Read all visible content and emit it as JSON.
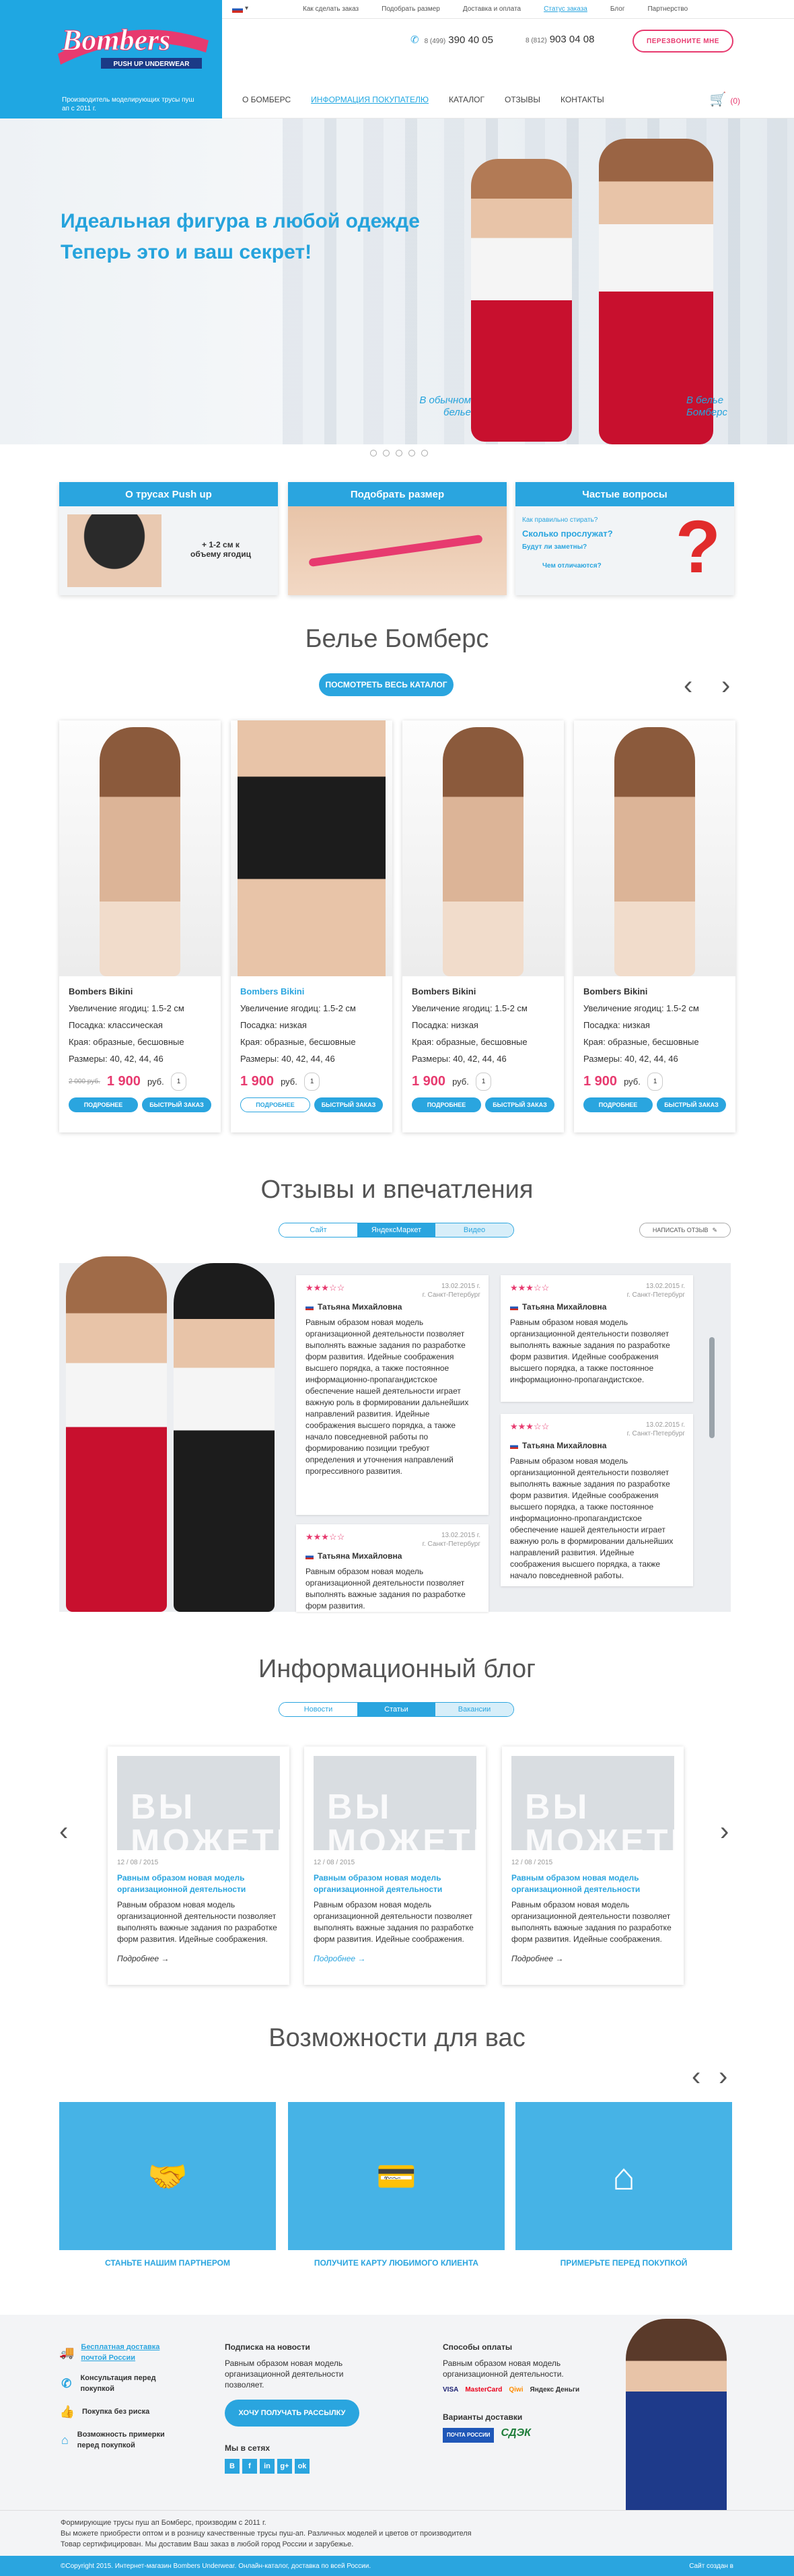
{
  "topbar": {
    "lang": "▾",
    "links": [
      "Как сделать заказ",
      "Подобрать размер",
      "Доставка и оплата",
      "Статус заказа",
      "Блог",
      "Партнерство"
    ]
  },
  "header": {
    "logo_text": "Bombers",
    "logo_sub": "PUSH UP UNDERWEAR",
    "tagline": "Производитель моделирующих трусы пуш ап с 2011 г.",
    "phone1_code": "8 (499)",
    "phone1": "390 40 05",
    "phone2_code": "8 (812)",
    "phone2": "903 04 08",
    "call_button": "ПЕРЕЗВОНИТЕ МНЕ",
    "cart_count": "(0)"
  },
  "nav": [
    "О БОМБЕРС",
    "ИНФОРМАЦИЯ ПОКУПАТЕЛЮ",
    "КАТАЛОГ",
    "ОТЗЫВЫ",
    "КОНТАКТЫ"
  ],
  "hero": {
    "line1": "Идеальная фигура в любой одежде",
    "line2": "Теперь это и ваш секрет!",
    "caption_left": "В обычном белье",
    "caption_right": "В белье Бомберс"
  },
  "features": [
    {
      "title": "О трусах Push up",
      "note": "+ 1-2 см к объему ягодиц"
    },
    {
      "title": "Подобрать размер"
    },
    {
      "title": "Частые вопросы",
      "q1": "Как правильно стирать?",
      "q2": "Сколько прослужат?",
      "q3": "Будут ли заметны?",
      "q4": "Чем отличаются?"
    }
  ],
  "catalog": {
    "title": "Белье Бомберс",
    "view_all": "ПОСМОТРЕТЬ ВЕСЬ КАТАЛОГ",
    "products": [
      {
        "name": "Bombers Bikini",
        "line1": "Увеличение ягодиц: 1.5-2 см",
        "line2": "Посадка: классическая",
        "line3": "Края: образные, бесшовные",
        "line4": "Размеры: 40, 42, 44, 46",
        "old_price": "2 000 руб.",
        "price": "1 900",
        "currency": "руб.",
        "qty": "1",
        "btn1": "ПОДРОБНЕЕ",
        "btn2": "БЫСТРЫЙ ЗАКАЗ"
      },
      {
        "name": "Bombers Bikini",
        "line1": "Увеличение ягодиц: 1.5-2 см",
        "line2": "Посадка: низкая",
        "line3": "Края: образные, бесшовные",
        "line4": "Размеры: 40, 42, 44, 46",
        "old_price": "",
        "price": "1 900",
        "currency": "руб.",
        "qty": "1",
        "btn1": "ПОДРОБНЕЕ",
        "btn2": "БЫСТРЫЙ ЗАКАЗ"
      },
      {
        "name": "Bombers Bikini",
        "line1": "Увеличение ягодиц: 1.5-2 см",
        "line2": "Посадка: низкая",
        "line3": "Края: образные, бесшовные",
        "line4": "Размеры: 40, 42, 44, 46",
        "old_price": "",
        "price": "1 900",
        "currency": "руб.",
        "qty": "1",
        "btn1": "ПОДРОБНЕЕ",
        "btn2": "БЫСТРЫЙ ЗАКАЗ"
      },
      {
        "name": "Bombers Bikini",
        "line1": "Увеличение ягодиц: 1.5-2 см",
        "line2": "Посадка: низкая",
        "line3": "Края: образные, бесшовные",
        "line4": "Размеры: 40, 42, 44, 46",
        "old_price": "",
        "price": "1 900",
        "currency": "руб.",
        "qty": "1",
        "btn1": "ПОДРОБНЕЕ",
        "btn2": "БЫСТРЫЙ ЗАКАЗ"
      }
    ]
  },
  "reviews": {
    "title": "Отзывы и впечатления",
    "tabs": [
      "Сайт",
      "ЯндексМаркет",
      "Видео"
    ],
    "write": "НАПИСАТЬ ОТЗЫВ",
    "items": [
      {
        "date": "13.02.2015 г.",
        "city": "г. Санкт-Петербург",
        "author": "Татьяна Михайловна",
        "text": "Равным образом новая модель организационной деятельности позволяет выполнять важные задания по разработке форм развития. Идейные соображения высшего порядка, а также постоянное информационно-пропагандистское обеспечение нашей деятельности играет важную роль в формировании дальнейших направлений развития. Идейные соображения высшего порядка, а также начало повседневной работы по формированию позиции требуют определения и уточнения направлений прогрессивного развития."
      },
      {
        "date": "13.02.2015 г.",
        "city": "г. Санкт-Петербург",
        "author": "Татьяна Михайловна",
        "text": "Равным образом новая модель организационной деятельности позволяет выполнять важные задания по разработке форм развития. Идейные соображения высшего порядка, а также постоянное информационно-пропагандистское."
      },
      {
        "date": "13.02.2015 г.",
        "city": "г. Санкт-Петербург",
        "author": "Татьяна Михайловна",
        "text": "Равным образом новая модель организационной деятельности позволяет выполнять важные задания по разработке форм развития."
      },
      {
        "date": "13.02.2015 г.",
        "city": "г. Санкт-Петербург",
        "author": "Татьяна Михайловна",
        "text": "Равным образом новая модель организационной деятельности позволяет выполнять важные задания по разработке форм развития. Идейные соображения высшего порядка, а также постоянное информационно-пропагандистское обеспечение нашей деятельности играет важную роль в формировании дальнейших направлений развития. Идейные соображения высшего порядка, а также начало повседневной работы."
      }
    ]
  },
  "blog": {
    "title": "Информационный блог",
    "tabs": [
      "Новости",
      "Статьи",
      "Вакансии"
    ],
    "items": [
      {
        "date": "12 / 08 / 2015",
        "title": "Равным образом новая модель организационной деятельности",
        "text": "Равным образом новая модель организационной деятельности позволяет выполнять важные задания по разработке форм развития. Идейные соображения.",
        "more": "Подробнее"
      },
      {
        "date": "12 / 08 / 2015",
        "title": "Равным образом новая модель организационной деятельности",
        "text": "Равным образом новая модель организационной деятельности позволяет выполнять важные задания по разработке форм развития. Идейные соображения.",
        "more": "Подробнее"
      },
      {
        "date": "12 / 08 / 2015",
        "title": "Равным образом новая модель организационной деятельности",
        "text": "Равным образом новая модель организационной деятельности позволяет выполнять важные задания по разработке форм развития. Идейные соображения.",
        "more": "Подробнее"
      }
    ],
    "thumb_text": "ВЫ МОЖЕТЕ"
  },
  "opportunities": {
    "title": "Возможности для вас",
    "items": [
      "СТАНЬТЕ НАШИМ ПАРТНЕРОМ",
      "ПОЛУЧИТЕ КАРТУ ЛЮБИМОГО КЛИЕНТА",
      "ПРИМЕРЬТЕ ПЕРЕД ПОКУПКОЙ"
    ]
  },
  "footer": {
    "advantages": [
      "Бесплатная доставка почтой России",
      "Консультация перед покупкой",
      "Покупка без риска",
      "Возможность примерки перед покупкой"
    ],
    "subscribe_title": "Подписка на новости",
    "subscribe_text": "Равным образом новая модель организационной деятельности позволяет.",
    "subscribe_btn": "ХОЧУ ПОЛУЧАТЬ РАССЫЛКУ",
    "social_title": "Мы в сетях",
    "social": [
      "В",
      "f",
      "in",
      "g+",
      "ok"
    ],
    "pay_title": "Способы оплаты",
    "pay_text": "Равным образом новая модель организационной деятельности.",
    "pay": [
      "VISA",
      "MasterCard",
      "Qiwi",
      "Яндекс Деньги"
    ],
    "delivery_title": "Варианты доставки",
    "delivery": [
      "ПОЧТА РОССИИ",
      "СДЭК"
    ],
    "about1": "Формирующие трусы пуш ап Бомберс, производим с 2011 г.",
    "about2": "Вы можете приобрести оптом и в розницу качественные трусы пуш-ап. Различных моделей и цветов от производителя",
    "about3": "Товар сертифицирован. Мы доставим Ваш заказ в любой город России и зарубежье.",
    "copyright": "©Copyright 2015. Интернет-магазин Bombers Underwear. Онлайн-каталог, доставка по всей России.",
    "made_by": "Сайт создан в"
  },
  "colors": {
    "accent": "#2aa5df",
    "pink": "#e73a6f"
  }
}
